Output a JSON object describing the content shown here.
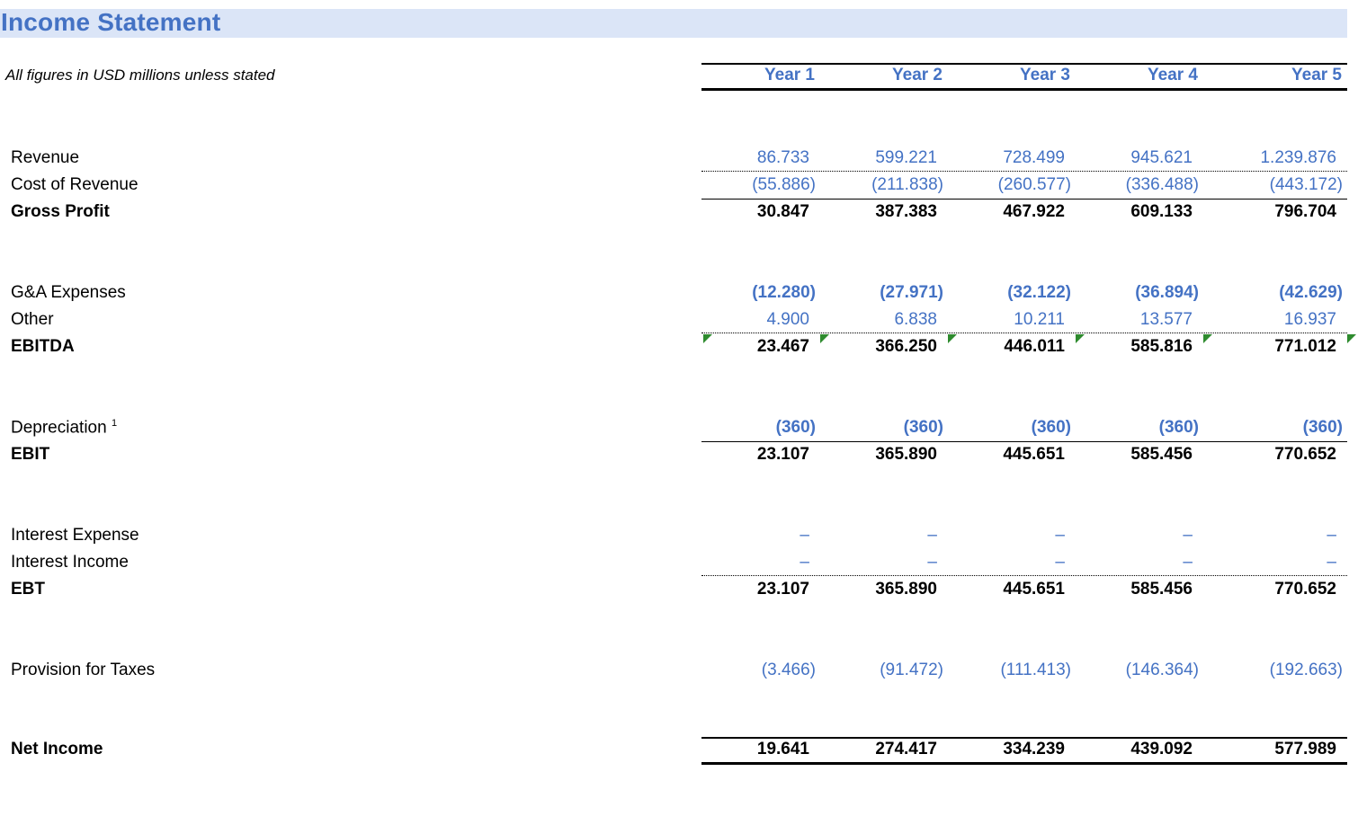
{
  "title": "Income Statement",
  "subtitle": "All figures in USD millions unless stated",
  "years": [
    "Year 1",
    "Year 2",
    "Year 3",
    "Year 4",
    "Year 5"
  ],
  "rows": {
    "revenue": {
      "label": "Revenue",
      "values": [
        "86.733",
        "599.221",
        "728.499",
        "945.621",
        "1.239.876"
      ]
    },
    "cost_of_revenue": {
      "label": "Cost of Revenue",
      "values": [
        "(55.886)",
        "(211.838)",
        "(260.577)",
        "(336.488)",
        "(443.172)"
      ]
    },
    "gross_profit": {
      "label": "Gross Profit",
      "values": [
        "30.847",
        "387.383",
        "467.922",
        "609.133",
        "796.704"
      ]
    },
    "ga_expenses": {
      "label": "G&A Expenses",
      "values": [
        "(12.280)",
        "(27.971)",
        "(32.122)",
        "(36.894)",
        "(42.629)"
      ]
    },
    "other": {
      "label": "Other",
      "values": [
        "4.900",
        "6.838",
        "10.211",
        "13.577",
        "16.937"
      ]
    },
    "ebitda": {
      "label": "EBITDA",
      "values": [
        "23.467",
        "366.250",
        "446.011",
        "585.816",
        "771.012"
      ]
    },
    "depreciation": {
      "label": "Depreciation",
      "footnote": "1",
      "values": [
        "(360)",
        "(360)",
        "(360)",
        "(360)",
        "(360)"
      ]
    },
    "ebit": {
      "label": "EBIT",
      "values": [
        "23.107",
        "365.890",
        "445.651",
        "585.456",
        "770.652"
      ]
    },
    "interest_expense": {
      "label": "Interest Expense",
      "values": [
        "–",
        "–",
        "–",
        "–",
        "–"
      ]
    },
    "interest_income": {
      "label": "Interest Income",
      "values": [
        "–",
        "–",
        "–",
        "–",
        "–"
      ]
    },
    "ebt": {
      "label": "EBT",
      "values": [
        "23.107",
        "365.890",
        "445.651",
        "585.456",
        "770.652"
      ]
    },
    "taxes": {
      "label": "Provision for Taxes",
      "values": [
        "(3.466)",
        "(91.472)",
        "(111.413)",
        "(146.364)",
        "(192.663)"
      ]
    },
    "net_income": {
      "label": "Net Income",
      "values": [
        "19.641",
        "274.417",
        "334.239",
        "439.092",
        "577.989"
      ]
    }
  },
  "colors": {
    "accent": "#4472c4",
    "title_band": "#dbe5f7",
    "note_marker": "#2e8b2e"
  }
}
